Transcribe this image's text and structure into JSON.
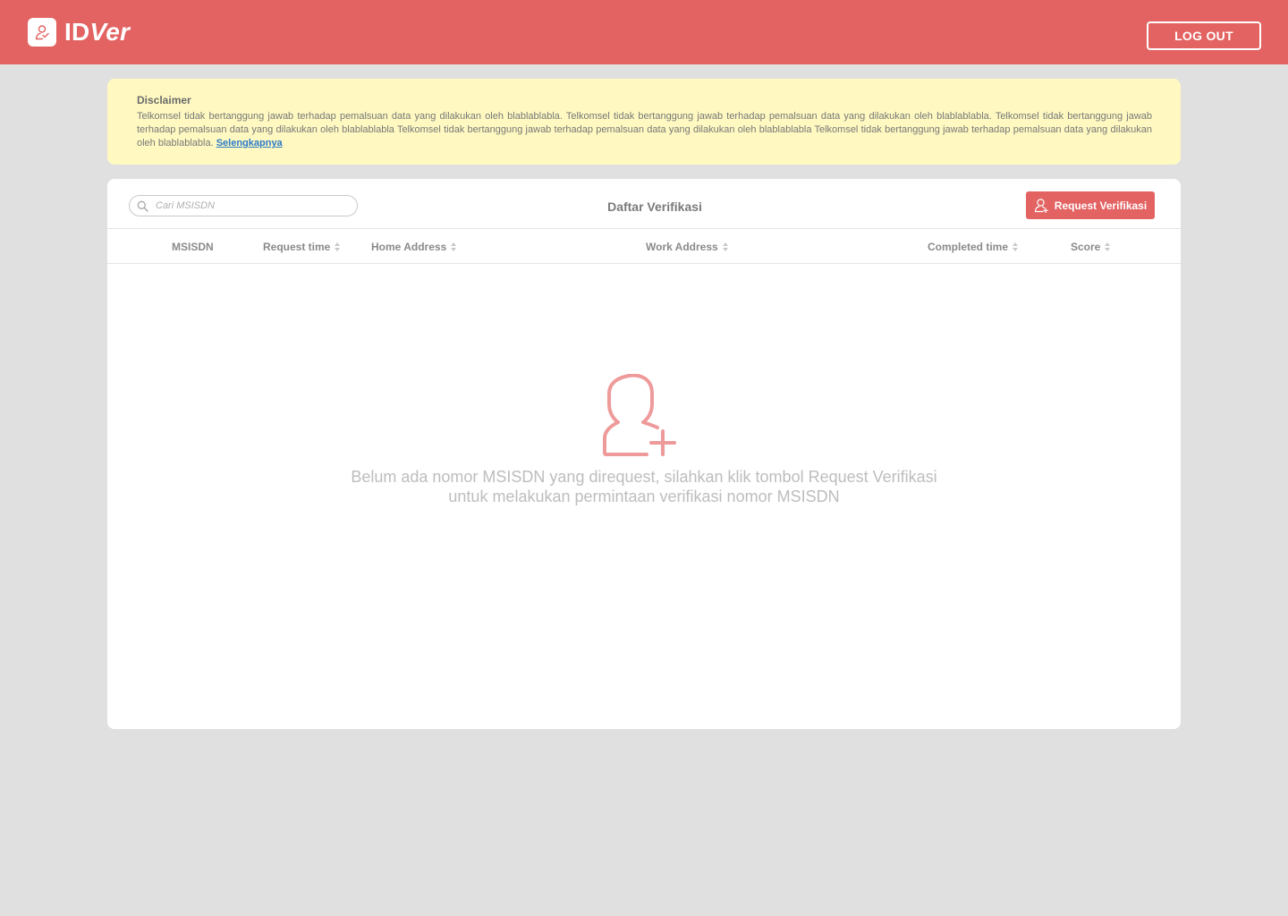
{
  "header": {
    "logo_icon": "user-check-icon",
    "app_name_prefix": "ID",
    "app_name_suffix": "Ver",
    "logout_label": "LOG OUT",
    "bg_color": "#e36262"
  },
  "disclaimer": {
    "title": "Disclaimer",
    "body": "Telkomsel tidak bertanggung jawab terhadap pemalsuan data yang dilakukan oleh blablablabla. Telkomsel tidak bertanggung jawab terhadap pemalsuan data yang dilakukan oleh blablablabla. Telkomsel tidak bertanggung jawab terhadap pemalsuan data yang dilakukan oleh blablablabla Telkomsel tidak bertanggung jawab terhadap pemalsuan data yang dilakukan oleh blablablabla Telkomsel tidak bertanggung jawab terhadap pemalsuan data yang dilakukan oleh blablablabla.",
    "link_label": "Selengkapnya",
    "bg_color": "#fff9c1"
  },
  "panel": {
    "search_placeholder": "Cari MSISDN",
    "search_icon": "search-icon",
    "title": "Daftar Verifikasi",
    "request_button_label": "Request Verifikasi",
    "request_button_icon": "user-add-icon",
    "accent_color": "#e36262"
  },
  "table": {
    "columns": [
      {
        "label": "MSISDN",
        "sortable": false
      },
      {
        "label": "Request time",
        "sortable": true
      },
      {
        "label": "Home Address",
        "sortable": true
      },
      {
        "label": "Work Address",
        "sortable": true
      },
      {
        "label": "Completed time",
        "sortable": true
      },
      {
        "label": "Score",
        "sortable": true
      }
    ]
  },
  "empty_state": {
    "icon": "user-add-icon",
    "line1": "Belum ada nomor MSISDN yang direquest, silahkan klik tombol Request Verifikasi",
    "line2": "untuk melakukan permintaan verifikasi nomor MSISDN"
  }
}
